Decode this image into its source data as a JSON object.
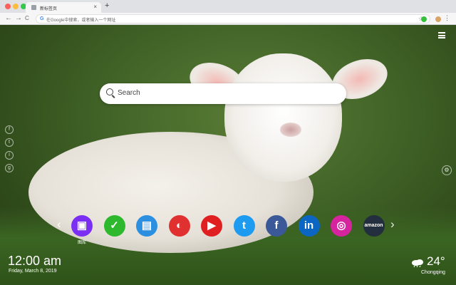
{
  "browser": {
    "tab_title": "新标签页",
    "tab_close": "×",
    "new_tab": "+",
    "back": "←",
    "forward": "→",
    "reload": "C",
    "omnibox_g": "G",
    "omnibox_placeholder": "在Google中搜索，或者输入一个网址",
    "bookmark_star": "☆",
    "menu": "⋮"
  },
  "search": {
    "placeholder": "Search"
  },
  "social_left": [
    "f",
    "t",
    "i",
    "g"
  ],
  "side_button": "⚙",
  "dock": {
    "prev": "‹",
    "next": "›",
    "items": [
      {
        "name": "gallery",
        "glyph": "▣",
        "label": "图库",
        "color": "#7b2ff2"
      },
      {
        "name": "tasks",
        "glyph": "✓",
        "label": "",
        "color": "#2db82d"
      },
      {
        "name": "notes",
        "glyph": "▤",
        "label": "",
        "color": "#2d8fe0"
      },
      {
        "name": "games",
        "glyph": "◐",
        "label": "",
        "color": "#e03030"
      },
      {
        "name": "youtube",
        "glyph": "▶",
        "label": "",
        "color": "#e02020"
      },
      {
        "name": "twitter",
        "glyph": "t",
        "label": "",
        "color": "#1d9bf0"
      },
      {
        "name": "facebook",
        "glyph": "f",
        "label": "",
        "color": "#3b5998"
      },
      {
        "name": "linkedin",
        "glyph": "in",
        "label": "",
        "color": "#0a66c2"
      },
      {
        "name": "instagram",
        "glyph": "◎",
        "label": "",
        "color": "#d6249f"
      },
      {
        "name": "amazon",
        "glyph": "amazon",
        "label": "",
        "color": "#232f3e"
      }
    ]
  },
  "clock": {
    "time": "12:00 am",
    "date": "Friday, March 8, 2019"
  },
  "weather": {
    "temp": "24°",
    "city": "Chongqing"
  }
}
